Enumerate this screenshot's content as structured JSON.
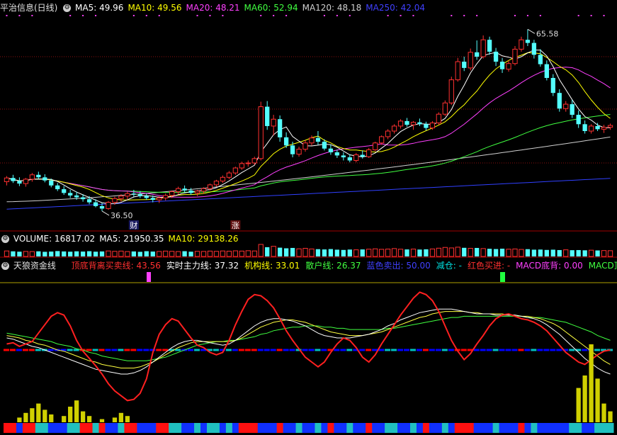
{
  "main_header": {
    "title": "平治信息(日线)",
    "ma_items": [
      {
        "label": "MA5: 49.96",
        "color": "#ffffff"
      },
      {
        "label": "MA10: 49.56",
        "color": "#ffff00"
      },
      {
        "label": "MA20: 48.21",
        "color": "#ff40ff"
      },
      {
        "label": "MA60: 52.94",
        "color": "#40ff40"
      },
      {
        "label": "MA120: 48.18",
        "color": "#d0d0d0"
      },
      {
        "label": "MA250: 42.04",
        "color": "#4040ff"
      }
    ]
  },
  "volume_header": {
    "items": [
      {
        "label": "VOLUME: 16817.02",
        "color": "#ffffff"
      },
      {
        "label": "MA5: 21950.35",
        "color": "#ffffff"
      },
      {
        "label": "MA10: 29138.26",
        "color": "#ffff00"
      }
    ]
  },
  "indicator_header": {
    "title": "天狼资金线",
    "items": [
      {
        "label": "顶底背离买卖线: 43.56",
        "color": "#ff3030"
      },
      {
        "label": "实时主力线: 37.32",
        "color": "#ffffff"
      },
      {
        "label": "机构线: 33.01",
        "color": "#ffff00"
      },
      {
        "label": "散户线: 26.37",
        "color": "#40ff40"
      },
      {
        "label": "蓝色卖出: 50.00",
        "color": "#4040ff"
      },
      {
        "label": "减仓: -",
        "color": "#00e0e0"
      },
      {
        "label": "红色买进: -",
        "color": "#ff3030"
      },
      {
        "label": "MACD底背: 0.00",
        "color": "#ff40ff"
      },
      {
        "label": "MACD顶背:",
        "color": "#40ff40"
      }
    ]
  },
  "price_annotations": {
    "high_label": "65.58",
    "low_label": "36.50",
    "event_tags": [
      "财",
      "涨"
    ]
  },
  "chart_data": {
    "type": "candlestick",
    "price_range": [
      34,
      68
    ],
    "high": 65.58,
    "low": 36.5,
    "candles_ohlc": [
      [
        41.2,
        42.1,
        40.6,
        41.8
      ],
      [
        41.8,
        42.3,
        41.0,
        41.3
      ],
      [
        41.3,
        41.9,
        40.5,
        40.9
      ],
      [
        40.9,
        41.8,
        40.4,
        41.6
      ],
      [
        41.6,
        42.6,
        41.2,
        42.3
      ],
      [
        42.3,
        42.8,
        41.6,
        41.9
      ],
      [
        41.9,
        42.4,
        41.1,
        41.4
      ],
      [
        41.4,
        41.7,
        40.3,
        40.6
      ],
      [
        40.6,
        41.0,
        39.7,
        40.0
      ],
      [
        40.0,
        40.5,
        39.1,
        39.4
      ],
      [
        39.4,
        39.9,
        38.6,
        39.0
      ],
      [
        39.0,
        39.6,
        38.3,
        38.7
      ],
      [
        38.7,
        39.2,
        38.0,
        38.4
      ],
      [
        38.4,
        38.9,
        37.6,
        37.9
      ],
      [
        37.9,
        38.4,
        37.1,
        37.3
      ],
      [
        37.3,
        37.8,
        36.5,
        36.9
      ],
      [
        36.9,
        38.1,
        36.7,
        37.9
      ],
      [
        37.9,
        38.8,
        37.5,
        38.5
      ],
      [
        38.5,
        39.2,
        38.0,
        38.9
      ],
      [
        38.9,
        39.6,
        38.4,
        39.3
      ],
      [
        39.3,
        39.9,
        38.8,
        39.2
      ],
      [
        39.2,
        39.7,
        38.6,
        38.9
      ],
      [
        38.9,
        39.3,
        38.3,
        38.6
      ],
      [
        38.6,
        39.0,
        37.9,
        38.3
      ],
      [
        38.3,
        38.9,
        37.8,
        38.6
      ],
      [
        38.6,
        39.3,
        38.2,
        39.0
      ],
      [
        39.0,
        39.8,
        38.6,
        39.6
      ],
      [
        39.6,
        40.4,
        39.2,
        40.1
      ],
      [
        40.1,
        40.6,
        39.5,
        39.8
      ],
      [
        39.8,
        40.2,
        39.1,
        39.4
      ],
      [
        39.4,
        39.9,
        38.9,
        39.7
      ],
      [
        39.7,
        40.3,
        39.3,
        40.1
      ],
      [
        40.1,
        40.9,
        39.8,
        40.7
      ],
      [
        40.7,
        41.5,
        40.4,
        41.3
      ],
      [
        41.3,
        42.2,
        41.0,
        41.9
      ],
      [
        41.9,
        42.9,
        41.6,
        42.6
      ],
      [
        42.6,
        43.6,
        42.3,
        43.4
      ],
      [
        43.4,
        44.4,
        43.1,
        44.1
      ],
      [
        44.1,
        44.6,
        43.6,
        44.2
      ],
      [
        44.2,
        45.2,
        43.9,
        44.9
      ],
      [
        44.9,
        54.0,
        44.6,
        53.2
      ],
      [
        53.2,
        54.1,
        49.5,
        50.1
      ],
      [
        50.1,
        51.9,
        48.6,
        51.2
      ],
      [
        51.2,
        51.8,
        47.6,
        48.3
      ],
      [
        48.3,
        49.1,
        46.6,
        47.0
      ],
      [
        47.0,
        47.6,
        45.1,
        45.6
      ],
      [
        45.6,
        46.8,
        45.2,
        46.4
      ],
      [
        46.4,
        47.8,
        46.0,
        47.4
      ],
      [
        47.4,
        48.6,
        47.0,
        48.2
      ],
      [
        48.2,
        49.3,
        47.1,
        47.6
      ],
      [
        47.6,
        48.0,
        46.2,
        46.5
      ],
      [
        46.5,
        47.1,
        45.5,
        45.9
      ],
      [
        45.9,
        46.3,
        45.0,
        45.4
      ],
      [
        45.4,
        45.9,
        44.6,
        45.1
      ],
      [
        45.1,
        45.6,
        44.3,
        44.6
      ],
      [
        44.6,
        45.8,
        44.3,
        45.5
      ],
      [
        45.5,
        46.2,
        44.9,
        45.2
      ],
      [
        45.2,
        46.6,
        45.0,
        46.3
      ],
      [
        46.3,
        47.6,
        46.1,
        47.4
      ],
      [
        47.4,
        48.6,
        47.1,
        48.4
      ],
      [
        48.4,
        49.6,
        48.0,
        49.3
      ],
      [
        49.3,
        50.4,
        48.9,
        50.1
      ],
      [
        50.1,
        51.2,
        49.7,
        50.9
      ],
      [
        50.9,
        51.4,
        50.0,
        50.3
      ],
      [
        50.3,
        50.9,
        49.5,
        50.7
      ],
      [
        50.7,
        51.3,
        50.1,
        50.4
      ],
      [
        50.4,
        50.8,
        49.4,
        49.8
      ],
      [
        49.8,
        50.9,
        49.5,
        50.6
      ],
      [
        50.6,
        52.3,
        50.3,
        52.0
      ],
      [
        52.0,
        54.2,
        51.7,
        53.8
      ],
      [
        53.8,
        58.0,
        53.5,
        57.5
      ],
      [
        57.5,
        61.0,
        57.2,
        60.4
      ],
      [
        60.4,
        61.2,
        58.9,
        59.4
      ],
      [
        59.4,
        62.5,
        59.0,
        61.9
      ],
      [
        61.9,
        63.8,
        60.7,
        61.2
      ],
      [
        61.2,
        64.6,
        60.9,
        63.9
      ],
      [
        63.9,
        64.4,
        61.5,
        62.0
      ],
      [
        62.0,
        62.6,
        59.7,
        60.4
      ],
      [
        60.4,
        61.0,
        58.6,
        59.2
      ],
      [
        59.2,
        60.6,
        58.8,
        60.1
      ],
      [
        60.1,
        62.9,
        59.8,
        62.4
      ],
      [
        62.4,
        64.4,
        62.0,
        63.9
      ],
      [
        63.9,
        65.58,
        62.9,
        63.4
      ],
      [
        63.4,
        63.9,
        60.9,
        61.5
      ],
      [
        61.5,
        62.4,
        59.6,
        60.0
      ],
      [
        60.0,
        60.6,
        57.4,
        57.8
      ],
      [
        57.8,
        58.4,
        54.9,
        55.4
      ],
      [
        55.4,
        56.0,
        52.4,
        52.9
      ],
      [
        52.9,
        54.1,
        52.4,
        53.6
      ],
      [
        53.6,
        54.3,
        51.4,
        51.9
      ],
      [
        51.9,
        52.6,
        49.8,
        50.4
      ],
      [
        50.4,
        51.0,
        48.9,
        49.3
      ],
      [
        49.3,
        50.4,
        48.9,
        50.1
      ],
      [
        50.1,
        50.6,
        49.3,
        49.6
      ],
      [
        49.6,
        50.3,
        49.0,
        49.9
      ],
      [
        49.9,
        50.5,
        49.5,
        50.2
      ]
    ],
    "volume": [
      4.4,
      4.1,
      3.8,
      4.0,
      3.9,
      4.1,
      3.7,
      3.9,
      4.3,
      4.0,
      3.8,
      4.1,
      3.9,
      4.2,
      3.8,
      4.0,
      4.4,
      4.1,
      4.3,
      3.9,
      4.0,
      3.7,
      4.2,
      3.9,
      4.0,
      4.3,
      4.1,
      3.9,
      4.2,
      3.8,
      4.1,
      4.0,
      4.3,
      4.1,
      4.4,
      4.2,
      4.5,
      4.3,
      4.6,
      4.4,
      9.6,
      7.4,
      8.1,
      7.0,
      6.5,
      6.8,
      6.1,
      6.5,
      6.0,
      5.8,
      5.6,
      5.9,
      5.4,
      5.2,
      5.5,
      5.3,
      5.6,
      5.8,
      6.1,
      5.7,
      5.9,
      6.3,
      5.8,
      5.6,
      5.9,
      5.5,
      5.7,
      6.0,
      6.6,
      7.2,
      6.8,
      7.4,
      6.9,
      6.5,
      6.8,
      6.3,
      6.1,
      5.9,
      6.2,
      5.8,
      6.0,
      5.6,
      5.8,
      5.4,
      5.5,
      5.2,
      5.4,
      5.1,
      5.3,
      5.0,
      5.1,
      4.9,
      5.0,
      4.8,
      4.7,
      4.6
    ],
    "indicator": {
      "red_line": [
        55,
        56,
        53,
        55,
        57,
        64,
        71,
        78,
        81,
        79,
        70,
        58,
        49,
        43,
        37,
        30,
        22,
        16,
        12,
        8,
        9,
        14,
        26,
        48,
        63,
        71,
        76,
        74,
        67,
        60,
        54,
        52,
        48,
        46,
        48,
        58,
        71,
        82,
        92,
        96,
        95,
        91,
        85,
        76,
        66,
        58,
        51,
        44,
        40,
        36,
        40,
        48,
        55,
        60,
        58,
        52,
        44,
        40,
        46,
        55,
        63,
        71,
        79,
        86,
        93,
        98,
        96,
        91,
        82,
        70,
        58,
        49,
        42,
        47,
        55,
        62,
        70,
        76,
        79,
        80,
        78,
        76,
        75,
        73,
        70,
        66,
        60,
        54,
        48,
        44,
        40,
        38,
        42,
        46,
        49,
        50
      ],
      "white_line": [
        60,
        59,
        57,
        55,
        53,
        52,
        50,
        48,
        46,
        44,
        42,
        40,
        38,
        36,
        34,
        33,
        32,
        31,
        30,
        30,
        31,
        33,
        36,
        40,
        44,
        48,
        52,
        55,
        57,
        58,
        58,
        57,
        56,
        55,
        54,
        55,
        58,
        62,
        66,
        70,
        73,
        75,
        76,
        76,
        75,
        74,
        72,
        70,
        67,
        64,
        62,
        61,
        60,
        60,
        60,
        61,
        62,
        63,
        65,
        67,
        70,
        72,
        75,
        77,
        79,
        81,
        82,
        83,
        84,
        84,
        84,
        83,
        82,
        81,
        80,
        80,
        80,
        79,
        79,
        79,
        79,
        78,
        77,
        76,
        74,
        71,
        67,
        63,
        58,
        53,
        48,
        43,
        39,
        35,
        32,
        30
      ],
      "yellow_line": [
        62,
        61,
        60,
        58,
        57,
        55,
        54,
        52,
        50,
        49,
        47,
        45,
        43,
        41,
        40,
        38,
        37,
        36,
        35,
        35,
        35,
        36,
        38,
        40,
        43,
        46,
        49,
        52,
        54,
        56,
        57,
        57,
        57,
        57,
        57,
        57,
        58,
        60,
        63,
        66,
        69,
        71,
        73,
        74,
        75,
        75,
        74,
        73,
        71,
        69,
        67,
        65,
        64,
        63,
        62,
        62,
        62,
        63,
        64,
        65,
        67,
        69,
        71,
        73,
        75,
        77,
        78,
        80,
        81,
        82,
        82,
        82,
        82,
        81,
        81,
        80,
        80,
        80,
        80,
        79,
        79,
        78,
        78,
        77,
        76,
        74,
        72,
        69,
        65,
        61,
        57,
        53,
        49,
        45,
        41,
        38
      ],
      "green_line": [
        64,
        63,
        62,
        61,
        60,
        59,
        58,
        57,
        55,
        54,
        53,
        51,
        50,
        48,
        47,
        45,
        44,
        43,
        42,
        41,
        41,
        41,
        41,
        42,
        43,
        44,
        46,
        48,
        50,
        52,
        54,
        55,
        56,
        57,
        57,
        58,
        58,
        59,
        60,
        61,
        63,
        64,
        66,
        67,
        68,
        69,
        69,
        70,
        70,
        70,
        69,
        69,
        68,
        68,
        67,
        67,
        67,
        67,
        67,
        67,
        68,
        68,
        69,
        70,
        71,
        72,
        73,
        74,
        75,
        76,
        77,
        77,
        78,
        78,
        78,
        78,
        78,
        78,
        78,
        78,
        78,
        78,
        77,
        77,
        77,
        76,
        75,
        74,
        73,
        71,
        69,
        67,
        65,
        62,
        60,
        58
      ],
      "signal_colors": [
        "#ff0000",
        "#ff0000",
        "#0000ff",
        "#ff0000",
        "#ff0000",
        "#00c0c0",
        "#00c0c0",
        "#0000ff",
        "#0000ff",
        "#0000ff",
        "#00c0c0",
        "#00c0c0",
        "#ff0000",
        "#ff0000",
        "#00c0c0",
        "#ff0000",
        "#0000ff",
        "#0000ff",
        "#00c0c0",
        "#ff0000",
        "#ff0000",
        "#0000ff",
        "#0000ff",
        "#0000ff",
        "#ff0000",
        "#ff0000",
        "#00c0c0",
        "#00c0c0",
        "#0000ff",
        "#0000ff",
        "#00c0c0",
        "#0000ff",
        "#00c0c0",
        "#00c0c0",
        "#0000ff",
        "#00c0c0",
        "#0000ff",
        "#ff0000",
        "#ff0000",
        "#ff0000",
        "#0000ff",
        "#0000ff",
        "#0000ff",
        "#ff0000",
        "#0000ff",
        "#0000ff",
        "#00c0c0",
        "#0000ff",
        "#0000ff",
        "#00c0c0",
        "#0000ff",
        "#ff0000",
        "#0000ff",
        "#0000ff",
        "#00c0c0",
        "#0000ff",
        "#0000ff",
        "#ff0000",
        "#0000ff",
        "#0000ff",
        "#00c0c0",
        "#00c0c0",
        "#0000ff",
        "#0000ff",
        "#00c0c0",
        "#0000ff",
        "#ff0000",
        "#0000ff",
        "#0000ff",
        "#00c0c0",
        "#0000ff",
        "#ff0000",
        "#ff0000",
        "#ff0000",
        "#0000ff",
        "#0000ff",
        "#0000ff",
        "#00c0c0",
        "#0000ff",
        "#0000ff",
        "#0000ff",
        "#ff0000",
        "#0000ff",
        "#00c0c0",
        "#0000ff",
        "#0000ff",
        "#0000ff",
        "#0000ff",
        "#0000ff",
        "#00c0c0",
        "#00c0c0",
        "#0000ff",
        "#0000ff",
        "#00c0c0",
        "#00c0c0",
        "#00c0c0"
      ],
      "yellow_bars": [
        {
          "i": 2,
          "v": 3
        },
        {
          "i": 3,
          "v": 6
        },
        {
          "i": 4,
          "v": 9
        },
        {
          "i": 5,
          "v": 12
        },
        {
          "i": 6,
          "v": 8
        },
        {
          "i": 7,
          "v": 5
        },
        {
          "i": 9,
          "v": 4
        },
        {
          "i": 10,
          "v": 10
        },
        {
          "i": 11,
          "v": 14
        },
        {
          "i": 12,
          "v": 7
        },
        {
          "i": 13,
          "v": 4
        },
        {
          "i": 15,
          "v": 2
        },
        {
          "i": 17,
          "v": 3
        },
        {
          "i": 18,
          "v": 6
        },
        {
          "i": 19,
          "v": 4
        },
        {
          "i": 90,
          "v": 22
        },
        {
          "i": 91,
          "v": 30
        },
        {
          "i": 92,
          "v": 50
        },
        {
          "i": 93,
          "v": 28
        },
        {
          "i": 94,
          "v": 12
        },
        {
          "i": 95,
          "v": 7
        }
      ]
    }
  }
}
